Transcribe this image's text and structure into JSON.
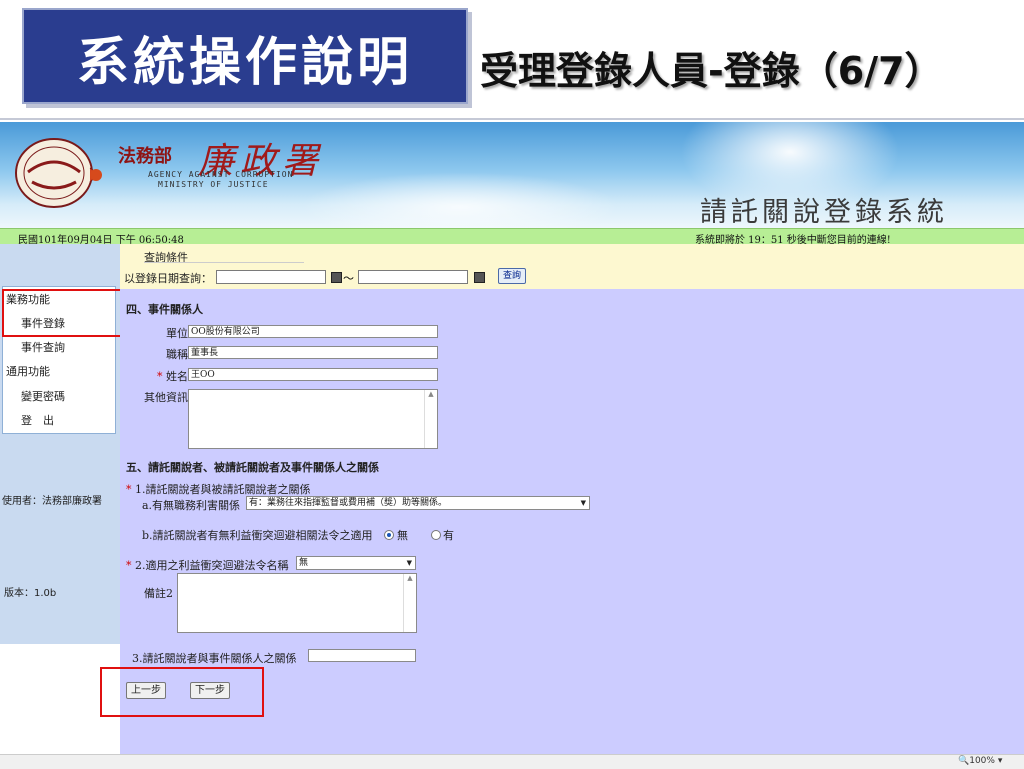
{
  "slide": {
    "title": "系統操作說明",
    "subtitle": "受理登錄人員-登錄（6/7）"
  },
  "banner": {
    "agency_cn": "法務部",
    "agency_brand": "廉政署",
    "agency_en_line1": "AGENCY AGAINST CORRUPTION",
    "agency_en_line2": "MINISTRY OF JUSTICE",
    "system_name": "請託關說登錄系統",
    "seal_text": "廉政署"
  },
  "status": {
    "datetime": "民國101年09月04日 下午 06:50:48",
    "notice": "系統即將於 19：51 秒後中斷您目前的連線!"
  },
  "sidebar": {
    "business_head": "業務功能",
    "items": [
      "事件登錄",
      "事件查詢"
    ],
    "general_head": "通用功能",
    "general_items": [
      "變更密碼",
      "登　出"
    ],
    "user": "使用者：法務部廉政署",
    "version": "版本：1.0b"
  },
  "query": {
    "legend": "查詢條件",
    "label": "以登錄日期查詢：",
    "from_value": "",
    "to_value": "",
    "tilde": "～",
    "button": "查詢"
  },
  "form": {
    "section4_title": "四、事件關係人",
    "unit_label": "單位",
    "unit_value": "OO股份有限公司",
    "title_label": "職稱",
    "title_value": "董事長",
    "name_req": "*",
    "name_label": "姓名",
    "name_value": "王OO",
    "other_label": "其他資訊",
    "section5_title": "五、請託關說者、被請託關說者及事件關係人之關係",
    "q1_req": "*",
    "q1_label": "1.請託關說者與被請託關說者之關係",
    "q1a_label": "a.有無職務利害關係",
    "q1a_value": "有：業務往來指揮監督或費用補（獎）助等關係。",
    "q1b_label": "b.請託關說者有無利益衝突迴避相關法令之適用",
    "q1b_opt_no": "無",
    "q1b_opt_yes": "有",
    "q2_req": "*",
    "q2_label": "2.適用之利益衝突迴避法令名稱",
    "q2_value": "無",
    "remark_label": "備註2",
    "q3_label": "3.請託關說者與事件關係人之關係",
    "q3_value": "",
    "prev_button": "上一步",
    "next_button": "下一步"
  },
  "browser": {
    "zoom": "100%"
  }
}
